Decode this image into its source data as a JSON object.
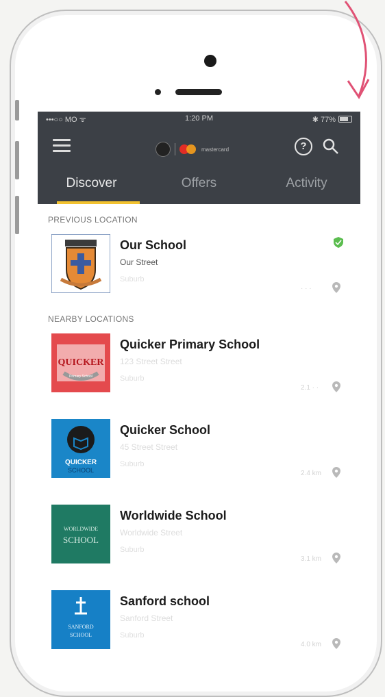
{
  "status_bar": {
    "carrier": "•••○○ MO ᯤ",
    "time": "1:20 PM",
    "battery": "✱ 77%"
  },
  "app_bar": {
    "logo_text": "mastercard"
  },
  "tabs": [
    {
      "label": "Discover",
      "active": true
    },
    {
      "label": "Offers",
      "active": false
    },
    {
      "label": "Activity",
      "active": false
    }
  ],
  "previous_section": {
    "title": "PREVIOUS LOCATION"
  },
  "previous": {
    "name": "Our School",
    "address": "Our Street",
    "city": "Suburb",
    "distance": "· · ·"
  },
  "nearby_section": {
    "title": "NEARBY LOCATIONS"
  },
  "nearby": [
    {
      "name": "Quicker Primary School",
      "address": "123 Street Street",
      "city": "Suburb",
      "distance": "2.1 · ·",
      "logo_text": "QUICKER",
      "logo_sub": "Primary School"
    },
    {
      "name": "Quicker School",
      "address": "45 Street Street",
      "city": "Suburb",
      "distance": "2.4 km",
      "logo_text": "QUICKER",
      "logo_sub": "SCHOOL"
    },
    {
      "name": "Worldwide School",
      "address": "Worldwide Street",
      "city": "Suburb",
      "distance": "3.1 km",
      "logo_text": "WORLDWIDE",
      "logo_sub": "SCHOOL"
    },
    {
      "name": "Sanford school",
      "address": "Sanford Street",
      "city": "Suburb",
      "distance": "4.0 km",
      "logo_text": "SANFORD",
      "logo_sub": "SCHOOL"
    }
  ],
  "colors": {
    "header": "#3c4046",
    "tab_indicator": "#f2c230",
    "verified": "#5bbd4f"
  }
}
